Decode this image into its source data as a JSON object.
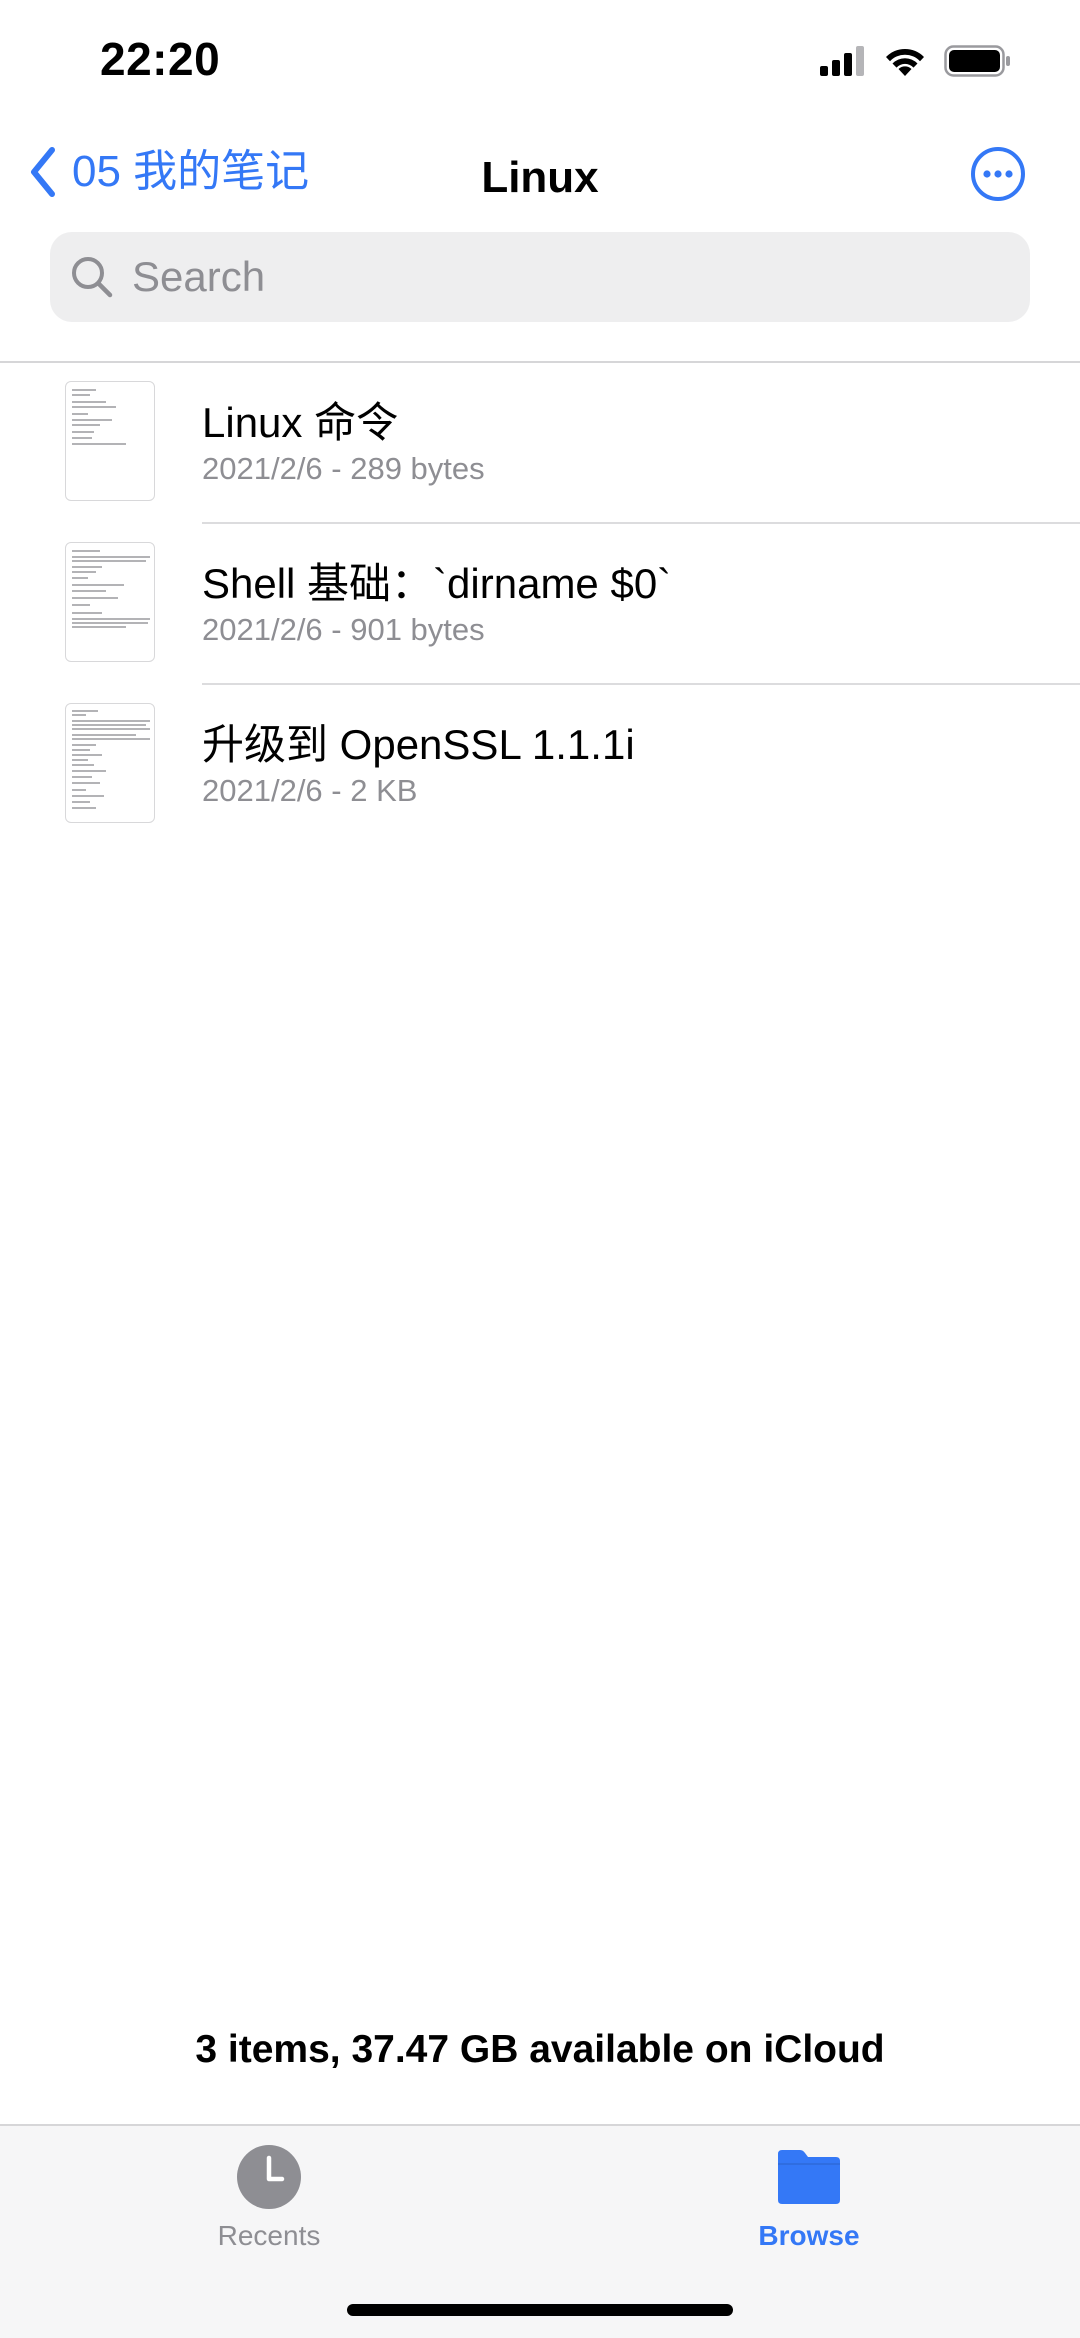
{
  "status_bar": {
    "time": "22:20",
    "icons": [
      "signal-icon",
      "wifi-icon",
      "battery-icon"
    ]
  },
  "nav": {
    "back_label": "05 我的笔记",
    "title": "Linux",
    "more_icon": "ellipsis-circle-icon"
  },
  "search": {
    "placeholder": "Search",
    "value": ""
  },
  "files": [
    {
      "name": "Linux 命令",
      "meta": "2021/2/6 - 289 bytes"
    },
    {
      "name": "Shell 基础：`dirname $0`",
      "meta": "2021/2/6 - 901 bytes"
    },
    {
      "name": "升级到 OpenSSL 1.1.1i",
      "meta": "2021/2/6 - 2 KB"
    }
  ],
  "footer": {
    "summary": "3 items, 37.47 GB available on iCloud"
  },
  "tabs": [
    {
      "label": "Recents",
      "icon": "clock-icon",
      "active": false
    },
    {
      "label": "Browse",
      "icon": "folder-icon",
      "active": true
    }
  ],
  "colors": {
    "accent": "#3478f6",
    "inactive_tab": "#8e8e93",
    "secondary_text": "#8e8e93"
  }
}
